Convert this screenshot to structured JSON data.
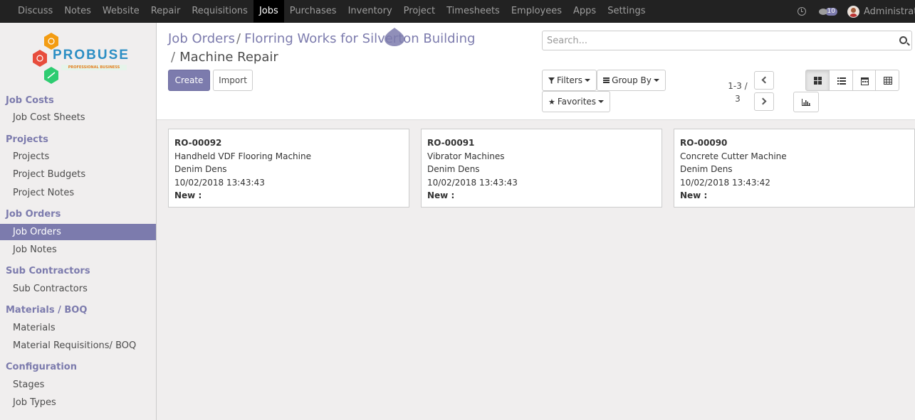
{
  "topbar": {
    "menu": [
      "Discuss",
      "Notes",
      "Website",
      "Repair",
      "Requisitions",
      "Jobs",
      "Purchases",
      "Inventory",
      "Project",
      "Timesheets",
      "Employees",
      "Apps",
      "Settings"
    ],
    "active_menu": "Jobs",
    "message_count": "10",
    "user_name": "Administrator"
  },
  "logo": {
    "name": "PROBUSE",
    "tagline": "PROFESSIONAL BUSINESS"
  },
  "sidebar": {
    "sections": [
      {
        "title": "Job Costs",
        "items": [
          "Job Cost Sheets"
        ]
      },
      {
        "title": "Projects",
        "items": [
          "Projects",
          "Project Budgets",
          "Project Notes"
        ]
      },
      {
        "title": "Job Orders",
        "items": [
          "Job Orders",
          "Job Notes"
        ]
      },
      {
        "title": "Sub Contractors",
        "items": [
          "Sub Contractors"
        ]
      },
      {
        "title": "Materials / BOQ",
        "items": [
          "Materials",
          "Material Requisitions/ BOQ"
        ]
      },
      {
        "title": "Configuration",
        "items": [
          "Stages",
          "Job Types"
        ]
      }
    ],
    "active_item": "Job Orders"
  },
  "breadcrumb": {
    "root": "Job Orders",
    "parent": "Florring Works for Silverton Building",
    "current": "Machine Repair",
    "separator": "/"
  },
  "buttons": {
    "create": "Create",
    "import": "Import"
  },
  "search": {
    "placeholder": "Search..."
  },
  "filters": {
    "filters_label": "Filters",
    "groupby_label": "Group By",
    "favorites_label": "Favorites"
  },
  "pager": {
    "value": "1-3 / 3"
  },
  "cards": [
    {
      "ref": "RO-00092",
      "name": "Handheld VDF Flooring Machine",
      "customer": "Denim Dens",
      "date": "10/02/2018 13:43:43",
      "stage": "New :"
    },
    {
      "ref": "RO-00091",
      "name": "Vibrator Machines",
      "customer": "Denim Dens",
      "date": "10/02/2018 13:43:43",
      "stage": "New :"
    },
    {
      "ref": "RO-00090",
      "name": "Concrete Cutter Machine",
      "customer": "Denim Dens",
      "date": "10/02/2018 13:43:42",
      "stage": "New :"
    }
  ],
  "colors": {
    "topbar_bg": "#222222",
    "accent": "#7c7bad",
    "sidebar_bg": "#f0eeee"
  }
}
